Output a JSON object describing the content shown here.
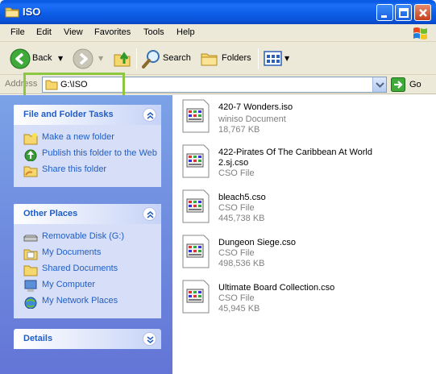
{
  "window": {
    "title": "ISO"
  },
  "menu": [
    "File",
    "Edit",
    "View",
    "Favorites",
    "Tools",
    "Help"
  ],
  "toolbar": {
    "back": "Back",
    "search": "Search",
    "folders": "Folders"
  },
  "address": {
    "label": "Address",
    "value": "G:\\ISO",
    "go": "Go"
  },
  "tasks": {
    "title": "File and Folder Tasks",
    "items": [
      {
        "label": "Make a new folder",
        "icon": "new-folder-icon"
      },
      {
        "label": "Publish this folder to the Web",
        "icon": "publish-web-icon"
      },
      {
        "label": "Share this folder",
        "icon": "share-folder-icon"
      }
    ]
  },
  "places": {
    "title": "Other Places",
    "items": [
      {
        "label": "Removable Disk (G:)",
        "icon": "removable-disk-icon"
      },
      {
        "label": "My Documents",
        "icon": "my-documents-icon"
      },
      {
        "label": "Shared Documents",
        "icon": "shared-documents-icon"
      },
      {
        "label": "My Computer",
        "icon": "my-computer-icon"
      },
      {
        "label": "My Network Places",
        "icon": "network-places-icon"
      }
    ]
  },
  "details": {
    "title": "Details"
  },
  "files": [
    {
      "name": "420-7 Wonders.iso",
      "type": "winiso Document",
      "size": "18,767 KB"
    },
    {
      "name": "422-Pirates Of The Caribbean At World 2.sj.cso",
      "type": "CSO File",
      "size": ""
    },
    {
      "name": "bleach5.cso",
      "type": "CSO File",
      "size": "445,738 KB"
    },
    {
      "name": "Dungeon Siege.cso",
      "type": "CSO File",
      "size": "498,536 KB"
    },
    {
      "name": "Ultimate Board Collection.cso",
      "type": "CSO File",
      "size": "45,945 KB"
    }
  ],
  "colors": {
    "titlebar": "#0a5ae3",
    "taskpane": "#6e8ddd",
    "link": "#215dc6",
    "highlight": "#8dc63f"
  }
}
